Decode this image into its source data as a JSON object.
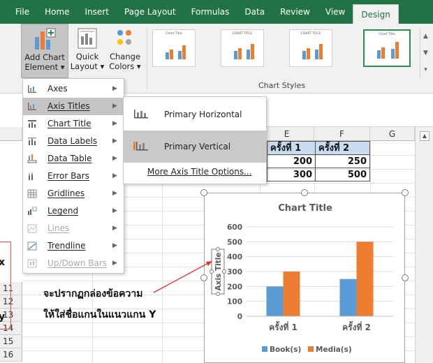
{
  "tabs": [
    "File",
    "Home",
    "Insert",
    "Page Layout",
    "Formulas",
    "Data",
    "Review",
    "View",
    "Design"
  ],
  "ribbon": {
    "add_chart_element": {
      "line1": "Add Chart",
      "line2": "Element ▾"
    },
    "quick_layout": {
      "line1": "Quick",
      "line2": "Layout ▾"
    },
    "change_colors": {
      "line1": "Change",
      "line2": "Colors ▾"
    },
    "chart_styles_label": "Chart Styles",
    "style_thumb_title": "Chart Title",
    "style_thumb_title_caps": "CHART TITLE"
  },
  "menu": {
    "items": [
      {
        "label": "Axes",
        "icon": "axes-icon",
        "disabled": false,
        "highlighted": false
      },
      {
        "label": "Axis Titles",
        "icon": "axis-titles-icon",
        "disabled": false,
        "highlighted": true
      },
      {
        "label": "Chart Title",
        "icon": "chart-title-icon",
        "disabled": false,
        "highlighted": false
      },
      {
        "label": "Data Labels",
        "icon": "data-labels-icon",
        "disabled": false,
        "highlighted": false
      },
      {
        "label": "Data Table",
        "icon": "data-table-icon",
        "disabled": false,
        "highlighted": false
      },
      {
        "label": "Error Bars",
        "icon": "error-bars-icon",
        "disabled": false,
        "highlighted": false
      },
      {
        "label": "Gridlines",
        "icon": "gridlines-icon",
        "disabled": false,
        "highlighted": false
      },
      {
        "label": "Legend",
        "icon": "legend-icon",
        "disabled": false,
        "highlighted": false
      },
      {
        "label": "Lines",
        "icon": "lines-icon",
        "disabled": true,
        "highlighted": false
      },
      {
        "label": "Trendline",
        "icon": "trendline-icon",
        "disabled": false,
        "highlighted": false
      },
      {
        "label": "Up/Down Bars",
        "icon": "up-down-bars-icon",
        "disabled": true,
        "highlighted": false
      }
    ]
  },
  "submenu": {
    "primary_horizontal": "Primary Horizontal",
    "primary_vertical": "Primary Vertical",
    "more_options": "More Axis Title Options..."
  },
  "sheet": {
    "columns": [
      "E",
      "F",
      "G"
    ],
    "rows": [
      "11",
      "12",
      "13",
      "14",
      "15",
      "16"
    ],
    "header_e": "ครั้งที่ 1",
    "header_f": "ครั้งที่ 2",
    "e_vals": [
      "200",
      "300"
    ],
    "f_vals": [
      "250",
      "500"
    ]
  },
  "annotation": {
    "line1": "จะปรากฏกล่องข้อความ",
    "line2": "ให้ใส่ชื่อแกนในแนวแกน Y",
    "edge_left_1": "x",
    "edge_left_2": "y"
  },
  "chart_data": {
    "type": "bar",
    "title": "Chart Title",
    "ylabel": "Axis Title",
    "categories": [
      "ครั้งที่ 1",
      "ครั้งที่ 2"
    ],
    "series": [
      {
        "name": "Book(s)",
        "values": [
          200,
          250
        ],
        "color": "#5b9bd5"
      },
      {
        "name": "Media(s)",
        "values": [
          300,
          500
        ],
        "color": "#ed7d31"
      }
    ],
    "ylim": [
      0,
      600
    ],
    "yticks": [
      "0",
      "100",
      "200",
      "300",
      "400",
      "500",
      "600"
    ],
    "legend": "bottom",
    "grid": true
  }
}
